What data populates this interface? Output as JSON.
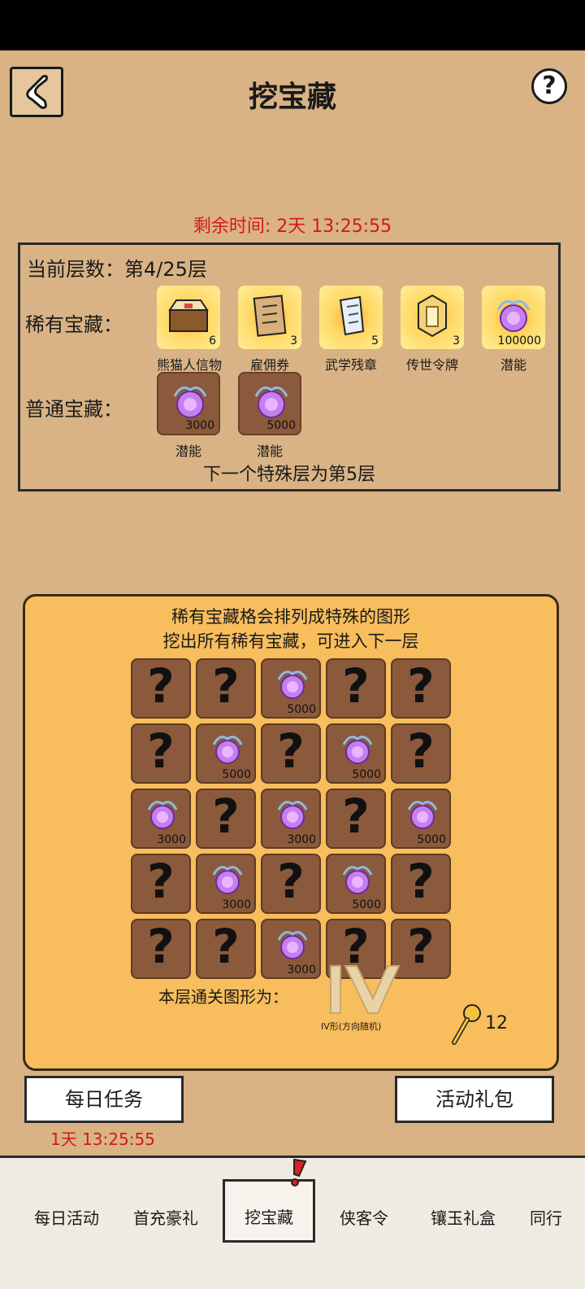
{
  "header": {
    "title": "挖宝藏",
    "help_label": "?"
  },
  "timer": {
    "remaining": "剩余时间: 2天 13:25:55"
  },
  "info": {
    "layer": "当前层数：第4/25层",
    "rare_label": "稀有宝藏：",
    "normal_label": "普通宝藏：",
    "rare_items": [
      {
        "count": "6",
        "name": "熊猫人信物",
        "icon": "chest-icon"
      },
      {
        "count": "3",
        "name": "雇佣券",
        "icon": "voucher-icon"
      },
      {
        "count": "5",
        "name": "武学残章",
        "icon": "scroll-icon"
      },
      {
        "count": "3",
        "name": "传世令牌",
        "icon": "token-icon"
      },
      {
        "count": "100000",
        "name": "潜能",
        "icon": "potential-orb-icon"
      }
    ],
    "normal_items": [
      {
        "count": "3000",
        "name": "潜能",
        "icon": "potential-orb-icon"
      },
      {
        "count": "5000",
        "name": "潜能",
        "icon": "potential-orb-icon"
      }
    ],
    "next_special": "下一个特殊层为第5层"
  },
  "game": {
    "hint_line1": "稀有宝藏格会排列成特殊的图形",
    "hint_line2": "挖出所有稀有宝藏，可进入下一层",
    "grid": [
      [
        "?",
        "?",
        "5000",
        "?",
        "?"
      ],
      [
        "?",
        "5000",
        "?",
        "5000",
        "?"
      ],
      [
        "3000",
        "?",
        "3000",
        "?",
        "5000"
      ],
      [
        "?",
        "3000",
        "?",
        "5000",
        "?"
      ],
      [
        "?",
        "?",
        "3000",
        "?",
        "?"
      ]
    ],
    "shape_label": "本层通关图形为：",
    "shape_caption": "IV形(方向随机)",
    "shovel_count": "12"
  },
  "buttons": {
    "daily": "每日任务",
    "gift": "活动礼包",
    "daily_timer": "1天 13:25:55"
  },
  "tabs": [
    "每日活动",
    "首充豪礼",
    "挖宝藏",
    "侠客令",
    "镶玉礼盒",
    "同行"
  ],
  "colors": {
    "accent_red": "#d21a1a",
    "panel": "#f8bd5c",
    "tile": "#8b5a3c",
    "bg": "#d9b385"
  }
}
